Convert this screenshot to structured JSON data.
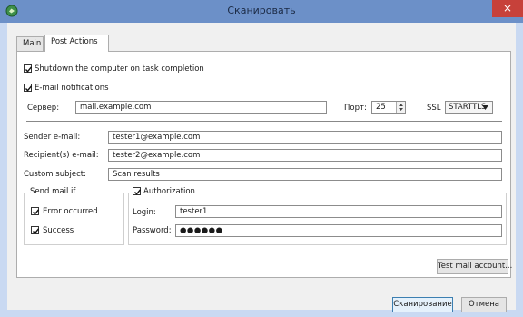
{
  "window": {
    "title": "Сканировать",
    "close_glyph": "×"
  },
  "tabs": [
    {
      "label": "Main",
      "active": false
    },
    {
      "label": "Post Actions",
      "active": true
    }
  ],
  "shutdown": {
    "label": "Shutdown the computer on task completion",
    "checked": true
  },
  "email": {
    "label": "E-mail notifications",
    "checked": true,
    "server_label": "Сервер:",
    "server_value": "mail.example.com",
    "port_label": "Порт:",
    "port_value": "25",
    "ssl_label": "SSL",
    "ssl_value": "STARTTLS",
    "sender_label": "Sender e-mail:",
    "sender_value": "tester1@example.com",
    "recipient_label": "Recipient(s) e-mail:",
    "recipient_value": "tester2@example.com",
    "subject_label": "Custom subject:",
    "subject_value": "Scan results"
  },
  "send_mail_if": {
    "title": "Send mail if",
    "error_label": "Error occurred",
    "error_checked": true,
    "success_label": "Success",
    "success_checked": true
  },
  "authorization": {
    "label": "Authorization",
    "checked": true,
    "login_label": "Login:",
    "login_value": "tester1",
    "password_label": "Password:",
    "password_value": "●●●●●●"
  },
  "buttons": {
    "test_mail": "Test mail account...",
    "scan": "Сканирование",
    "cancel": "Отмена"
  },
  "colors": {
    "titlebar": "#6c90c8",
    "close": "#c7413a",
    "frame": "#c9d9f2"
  }
}
